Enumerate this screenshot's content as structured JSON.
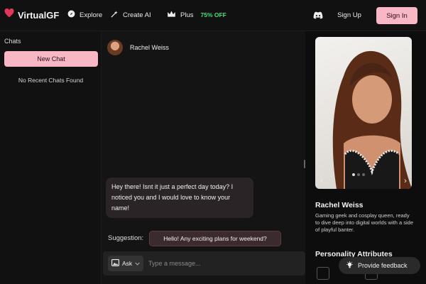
{
  "brand": {
    "name": "VirtualGF"
  },
  "nav": {
    "explore": "Explore",
    "create_ai": "Create AI",
    "plus": "Plus",
    "plus_badge": "75% OFF",
    "sign_up": "Sign Up",
    "sign_in": "Sign In"
  },
  "sidebar": {
    "heading": "Chats",
    "new_chat": "New Chat",
    "empty": "No Recent Chats Found"
  },
  "chat": {
    "name": "Rachel Weiss",
    "messages": [
      {
        "from": "bot",
        "text": "Hey there! Isnt it just a perfect day today? I noticed you and I would love to know your name!"
      }
    ],
    "suggestion_label": "Suggestion:",
    "suggestion": "Hello! Any exciting plans for weekend?",
    "ask_label": "Ask",
    "input_placeholder": "Type a message..."
  },
  "profile": {
    "name": "Rachel Weiss",
    "bio": "Gaming geek and cosplay queen, ready to dive deep into digital worlds with a side of playful banter.",
    "attributes_title": "Personality Attributes"
  },
  "feedback": {
    "label": "Provide feedback"
  },
  "colors": {
    "accent_pink": "#f7b7c4",
    "discount_green": "#4ade80",
    "background": "#0f0f0f"
  },
  "icons": {
    "brand": "heart-icon",
    "explore": "compass-icon",
    "create": "magic-wand-icon",
    "plus": "crown-icon",
    "discord": "discord-icon",
    "ask": "image-icon",
    "feedback": "lightbulb-icon"
  }
}
